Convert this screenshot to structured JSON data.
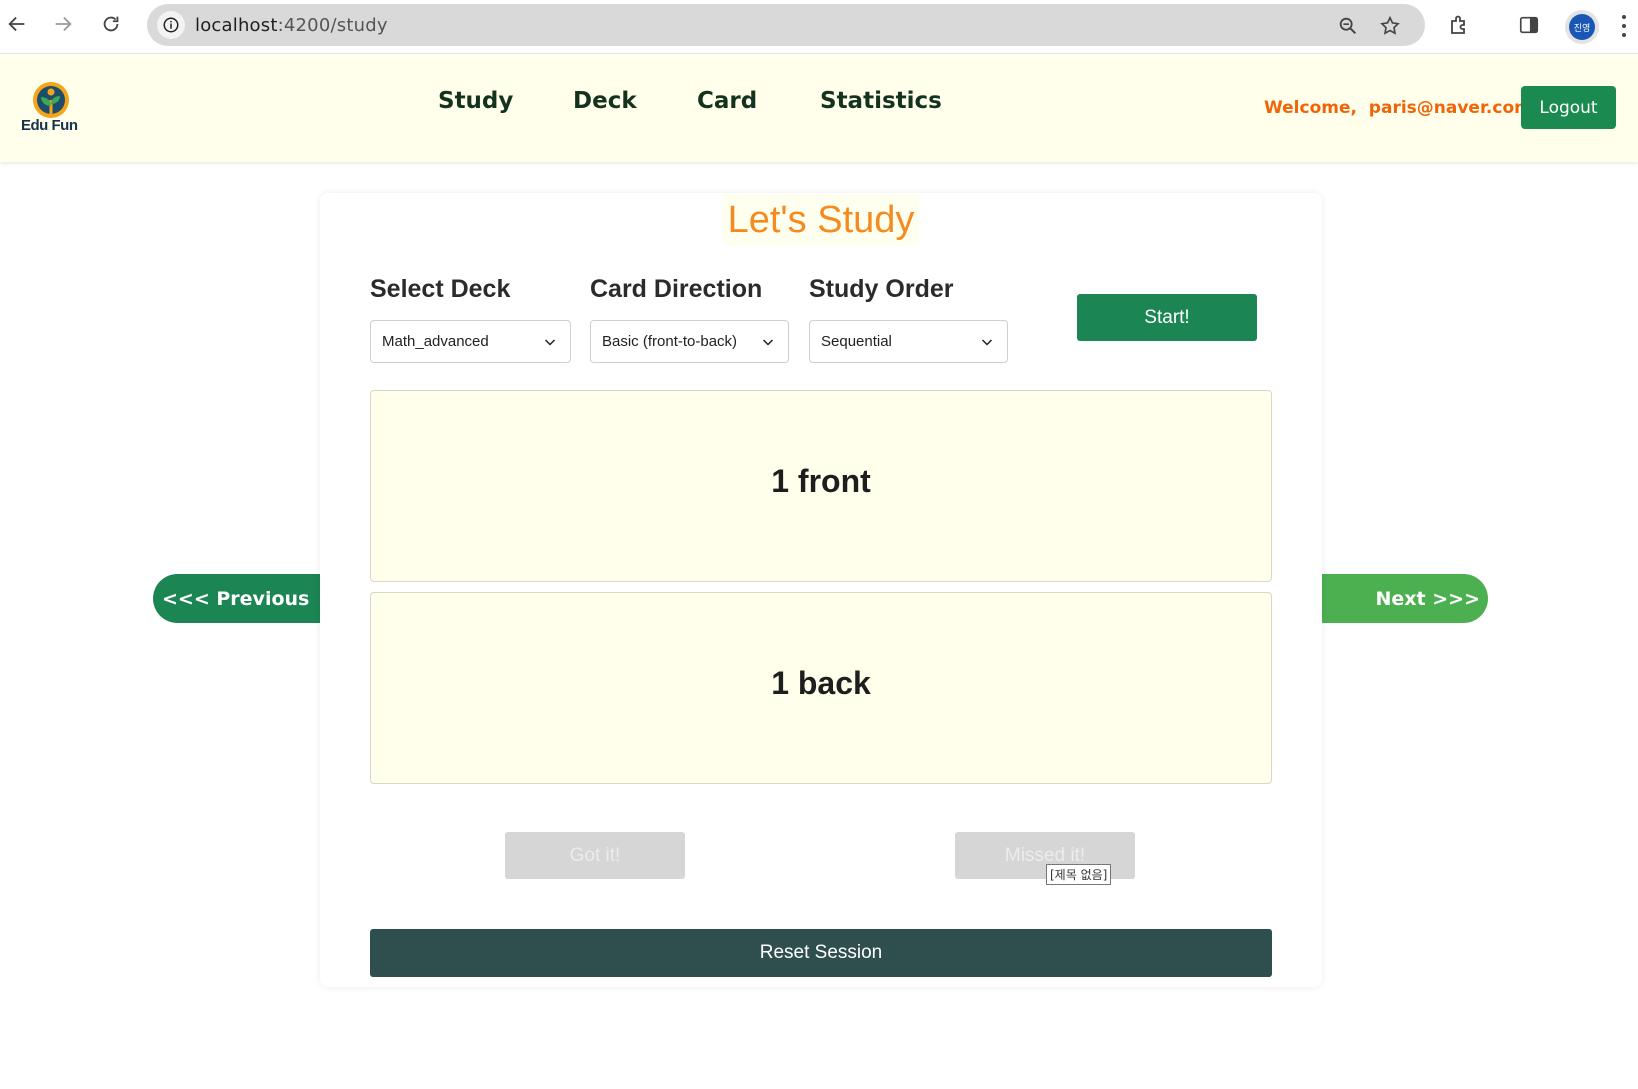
{
  "browser": {
    "url_host": "localhost",
    "url_path": ":4200/study",
    "profile_initials": "진영"
  },
  "header": {
    "logo_text": "Edu Fun",
    "nav": [
      "Study",
      "Deck",
      "Card",
      "Statistics"
    ],
    "welcome": "Welcome,  paris@naver.com!",
    "logout_label": "Logout"
  },
  "study": {
    "title": "Let's Study",
    "select_deck_label": "Select Deck",
    "select_deck_value": "Math_advanced",
    "card_direction_label": "Card Direction",
    "card_direction_value": "Basic (front-to-back)",
    "study_order_label": "Study Order",
    "study_order_value": "Sequential",
    "start_label": "Start!",
    "front_text": "1 front",
    "back_text": "1 back",
    "previous_label": "<<< Previous",
    "next_label": "Next >>>",
    "got_it_label": "Got it!",
    "missed_it_label": "Missed it!",
    "tooltip_text": "[제목 없음]",
    "reset_label": "Reset Session"
  },
  "colors": {
    "primary_green": "#1b8553",
    "next_green": "#4caf50",
    "accent_orange": "#f58b1f",
    "header_bg": "#ffffeb",
    "reset_bg": "#2f4f4f"
  }
}
